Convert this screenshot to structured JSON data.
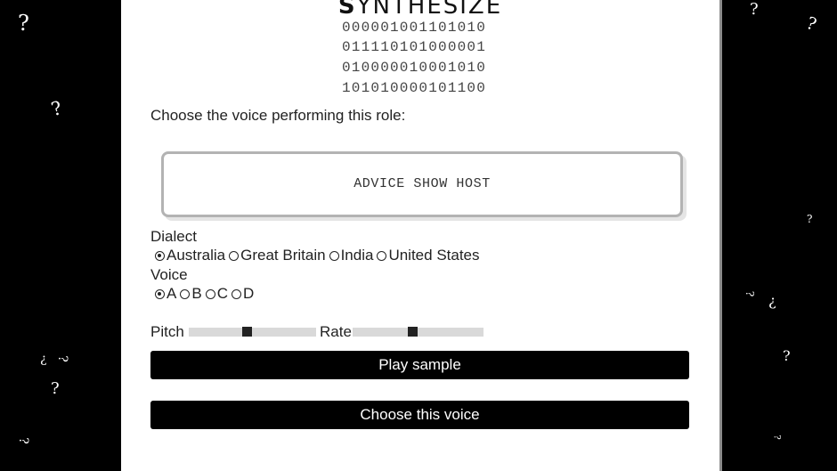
{
  "title": {
    "first_letter": "S",
    "rest": "YNTHESIZE"
  },
  "binary_lines": [
    "000001001101010",
    "011110101000001",
    "010000010001010",
    "101010000101100"
  ],
  "prompt": "Choose the voice performing this role:",
  "role": "ADVICE SHOW HOST",
  "dialect": {
    "label": "Dialect",
    "options": [
      "Australia",
      "Great Britain",
      "India",
      "United States"
    ],
    "selected": "Australia"
  },
  "voice": {
    "label": "Voice",
    "options": [
      "A",
      "B",
      "C",
      "D"
    ],
    "selected": "A"
  },
  "pitch": {
    "label": "Pitch",
    "level": 0.45
  },
  "rate": {
    "label": "Rate",
    "level": 0.45
  },
  "buttons": {
    "play": "Play sample",
    "choose": "Choose this voice"
  },
  "decor": {
    "glyph": "?",
    "inverted_glyph": "¿"
  }
}
